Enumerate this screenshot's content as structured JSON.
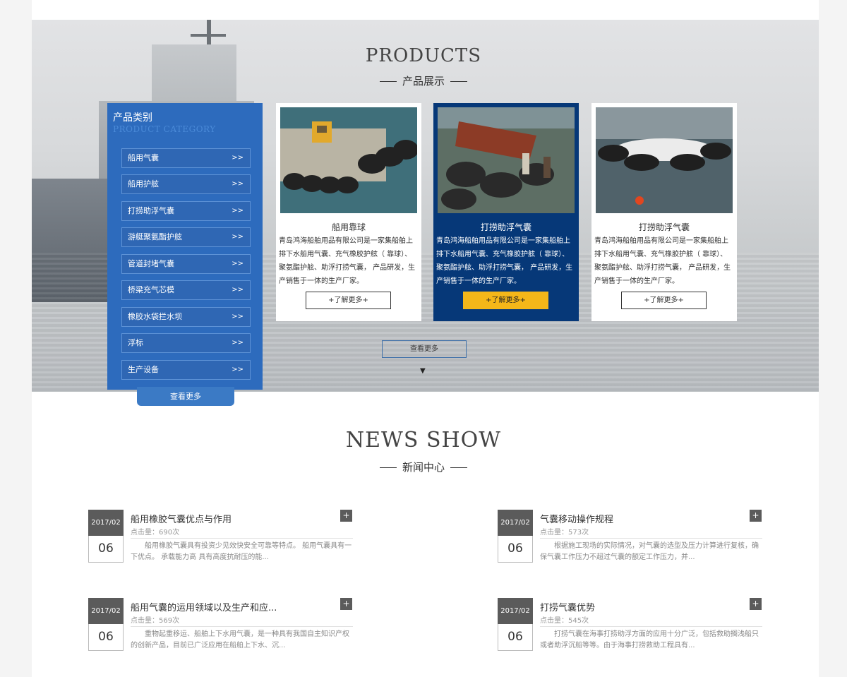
{
  "products": {
    "title": "PRODUCTS",
    "subtitle": "产品展示",
    "category_title": "产品类别",
    "category_title_en": "PRODUCT CATEGORY",
    "categories": [
      {
        "label": "船用气囊",
        "arrow": ">>"
      },
      {
        "label": "船用护舷",
        "arrow": ">>"
      },
      {
        "label": "打捞助浮气囊",
        "arrow": ">>"
      },
      {
        "label": "游艇聚氨酯护舷",
        "arrow": ">>"
      },
      {
        "label": "管道封堵气囊",
        "arrow": ">>"
      },
      {
        "label": "桥梁充气芯模",
        "arrow": ">>"
      },
      {
        "label": "橡胶水袋拦水坝",
        "arrow": ">>"
      },
      {
        "label": "浮标",
        "arrow": ">>"
      },
      {
        "label": "生产设备",
        "arrow": ">>"
      }
    ],
    "category_more": "查看更多",
    "cards": [
      {
        "name": "船用靠球",
        "desc": "青岛鸿海船舶用品有限公司是一家集船舶上排下水船用气囊、充气橡胶护舷（ 靠球）、聚氨酯护舷、助浮打捞气囊， 产品研发，生产销售于一体的生产厂家。",
        "more": "+了解更多+"
      },
      {
        "name": "打捞助浮气囊",
        "desc": "青岛鸿海船舶用品有限公司是一家集船舶上排下水船用气囊、充气橡胶护舷（ 靠球）、聚氨酯护舷、助浮打捞气囊， 产品研发，生产销售于一体的生产厂家。",
        "more": "+了解更多+"
      },
      {
        "name": "打捞助浮气囊",
        "desc": "青岛鸿海船舶用品有限公司是一家集船舶上排下水船用气囊、充气橡胶护舷（ 靠球）、聚氨酯护舷、助浮打捞气囊， 产品研发，生产销售于一体的生产厂家。",
        "more": "+了解更多+"
      }
    ],
    "more": "查看更多",
    "down_arrow": "▼"
  },
  "news": {
    "title": "NEWS SHOW",
    "subtitle": "新闻中心",
    "items": [
      {
        "ym": "2017/02",
        "day": "06",
        "title": "船用橡胶气囊优点与作用",
        "hits": "点击量：690次",
        "summary": "船用橡胶气囊具有投资少见效快安全可靠等特点。 船用气囊具有一下优点。 承载能力高 具有高度抗耐压的能...",
        "plus": "+"
      },
      {
        "ym": "2017/02",
        "day": "06",
        "title": "气囊移动操作规程",
        "hits": "点击量：573次",
        "summary": "根据施工现场的实际情况，对气囊的选型及压力计算进行复核，确保气囊工作压力不超过气囊的额定工作压力，并...",
        "plus": "+"
      },
      {
        "ym": "2017/02",
        "day": "06",
        "title": "船用气囊的运用领域以及生产和应...",
        "hits": "点击量：569次",
        "summary": "重物起重移运、船舶上下水用气囊，是一种具有我国自主知识产权的创新产品，目前已广泛应用在船舶上下水、沉...",
        "plus": "+"
      },
      {
        "ym": "2017/02",
        "day": "06",
        "title": "打捞气囊优势",
        "hits": "点击量：545次",
        "summary": "打捞气囊在海事打捞助浮方面的应用十分广泛，包括救助搁浅船只或者助浮沉船等等。由于海事打捞救助工程具有...",
        "plus": "+"
      }
    ]
  },
  "colors": {
    "category_panel": "#2d6bbd",
    "active_card": "#063878",
    "active_button": "#f4b719",
    "date_box": "#5b5b5b"
  }
}
